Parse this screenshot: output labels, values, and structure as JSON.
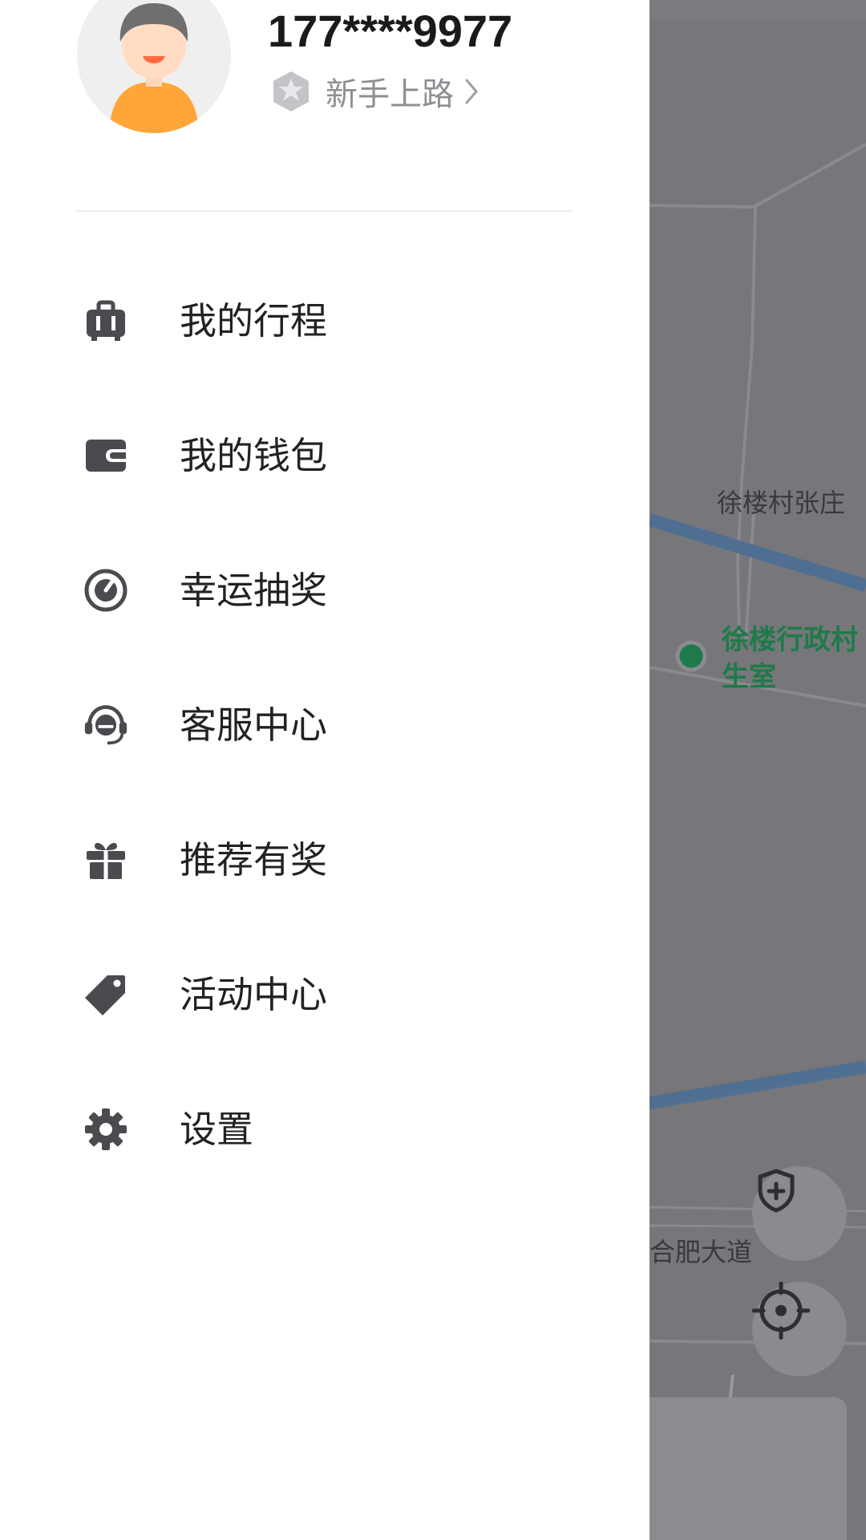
{
  "profile": {
    "phone": "177****9977",
    "level": "新手上路",
    "avatar_icon": "user-avatar-icon",
    "level_icon": "star-badge-icon"
  },
  "menu": {
    "items": [
      {
        "label": "我的行程",
        "icon": "luggage-icon"
      },
      {
        "label": "我的钱包",
        "icon": "wallet-icon"
      },
      {
        "label": "幸运抽奖",
        "icon": "lottery-icon"
      },
      {
        "label": "客服中心",
        "icon": "headset-icon"
      },
      {
        "label": "推荐有奖",
        "icon": "gift-icon"
      },
      {
        "label": "活动中心",
        "icon": "tag-icon"
      },
      {
        "label": "设置",
        "icon": "gear-icon"
      }
    ]
  },
  "map": {
    "poi_label_line1": "徐楼行政村",
    "poi_label_line2": "生室",
    "village_label": "徐楼村张庄",
    "road_label": "合肥大道",
    "safety_button_icon": "shield-plus-icon",
    "locate_button_icon": "locate-crosshair-icon"
  },
  "colors": {
    "drawer_bg": "#ffffff",
    "map_overlay": "#76767b",
    "poi_green": "#1f7a49",
    "road_blue": "#4e6f92",
    "icon_gray": "#4a4a4f"
  }
}
